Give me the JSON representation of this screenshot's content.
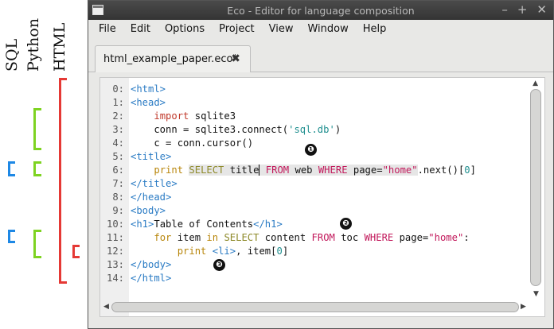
{
  "annotations": {
    "labels": {
      "sql": "SQL",
      "python": "Python",
      "html": "HTML"
    },
    "colors": {
      "sql": "#1e88e5",
      "python": "#7ed321",
      "html": "#e53935"
    },
    "markers": [
      "❶",
      "❷",
      "❸"
    ]
  },
  "window": {
    "title": "Eco - Editor for language composition",
    "controls": [
      "–",
      "+",
      "✕"
    ]
  },
  "menu": [
    "File",
    "Edit",
    "Options",
    "Project",
    "View",
    "Window",
    "Help"
  ],
  "tab": {
    "label": "html_example_paper.eco*",
    "close": "✖"
  },
  "editor": {
    "line_numbers": [
      "0:",
      "1:",
      "2:",
      "3:",
      "4:",
      "5:",
      "6:",
      "7:",
      "8:",
      "9:",
      "10:",
      "11:",
      "12:",
      "13:",
      "14:"
    ],
    "lines": [
      [
        {
          "t": "<html>",
          "c": "k-html"
        }
      ],
      [
        {
          "t": "<head>",
          "c": "k-html"
        }
      ],
      [
        {
          "t": "    "
        },
        {
          "t": "import",
          "c": "k-py"
        },
        {
          "t": " sqlite3"
        }
      ],
      [
        {
          "t": "    conn = sqlite3.connect("
        },
        {
          "t": "'sql.db'",
          "c": "str"
        },
        {
          "t": ")"
        }
      ],
      [
        {
          "t": "    c = conn.cursor()"
        }
      ],
      [
        {
          "t": "<title>",
          "c": "k-html"
        }
      ],
      [
        {
          "t": "    "
        },
        {
          "t": "print",
          "c": "k-pyk"
        },
        {
          "t": " "
        },
        {
          "t": "SELECT",
          "c": "k-sqlk sql-bg"
        },
        {
          "t": " title",
          "c": "sql-bg"
        },
        {
          "t": " ",
          "c": "sql-bg cursor"
        },
        {
          "t": "FROM",
          "c": "k-sql sql-bg"
        },
        {
          "t": " web ",
          "c": "sql-bg"
        },
        {
          "t": "WHERE",
          "c": "k-sql sql-bg"
        },
        {
          "t": " page=",
          "c": "sql-bg"
        },
        {
          "t": "\"home\"",
          "c": "str-sql sql-bg"
        },
        {
          "t": ".next()["
        },
        {
          "t": "0",
          "c": "str"
        },
        {
          "t": "]"
        }
      ],
      [
        {
          "t": "</title>",
          "c": "k-html"
        }
      ],
      [
        {
          "t": "</head>",
          "c": "k-html"
        }
      ],
      [
        {
          "t": "<body>",
          "c": "k-html"
        }
      ],
      [
        {
          "t": "<h1>",
          "c": "k-html"
        },
        {
          "t": "Table of Contents"
        },
        {
          "t": "</h1>",
          "c": "k-html"
        }
      ],
      [
        {
          "t": "    "
        },
        {
          "t": "for",
          "c": "k-pyk"
        },
        {
          "t": " item "
        },
        {
          "t": "in",
          "c": "k-pyk"
        },
        {
          "t": " "
        },
        {
          "t": "SELECT",
          "c": "k-sqlk"
        },
        {
          "t": " content "
        },
        {
          "t": "FROM",
          "c": "k-sql"
        },
        {
          "t": " toc "
        },
        {
          "t": "WHERE",
          "c": "k-sql"
        },
        {
          "t": " page="
        },
        {
          "t": "\"home\"",
          "c": "str-sql"
        },
        {
          "t": ":"
        }
      ],
      [
        {
          "t": "        "
        },
        {
          "t": "print",
          "c": "k-pyk"
        },
        {
          "t": " "
        },
        {
          "t": "<li>",
          "c": "k-html"
        },
        {
          "t": ", item["
        },
        {
          "t": "0",
          "c": "str"
        },
        {
          "t": "]"
        }
      ],
      [
        {
          "t": "</body>",
          "c": "k-html"
        }
      ],
      [
        {
          "t": "</html>",
          "c": "k-html"
        }
      ]
    ]
  }
}
